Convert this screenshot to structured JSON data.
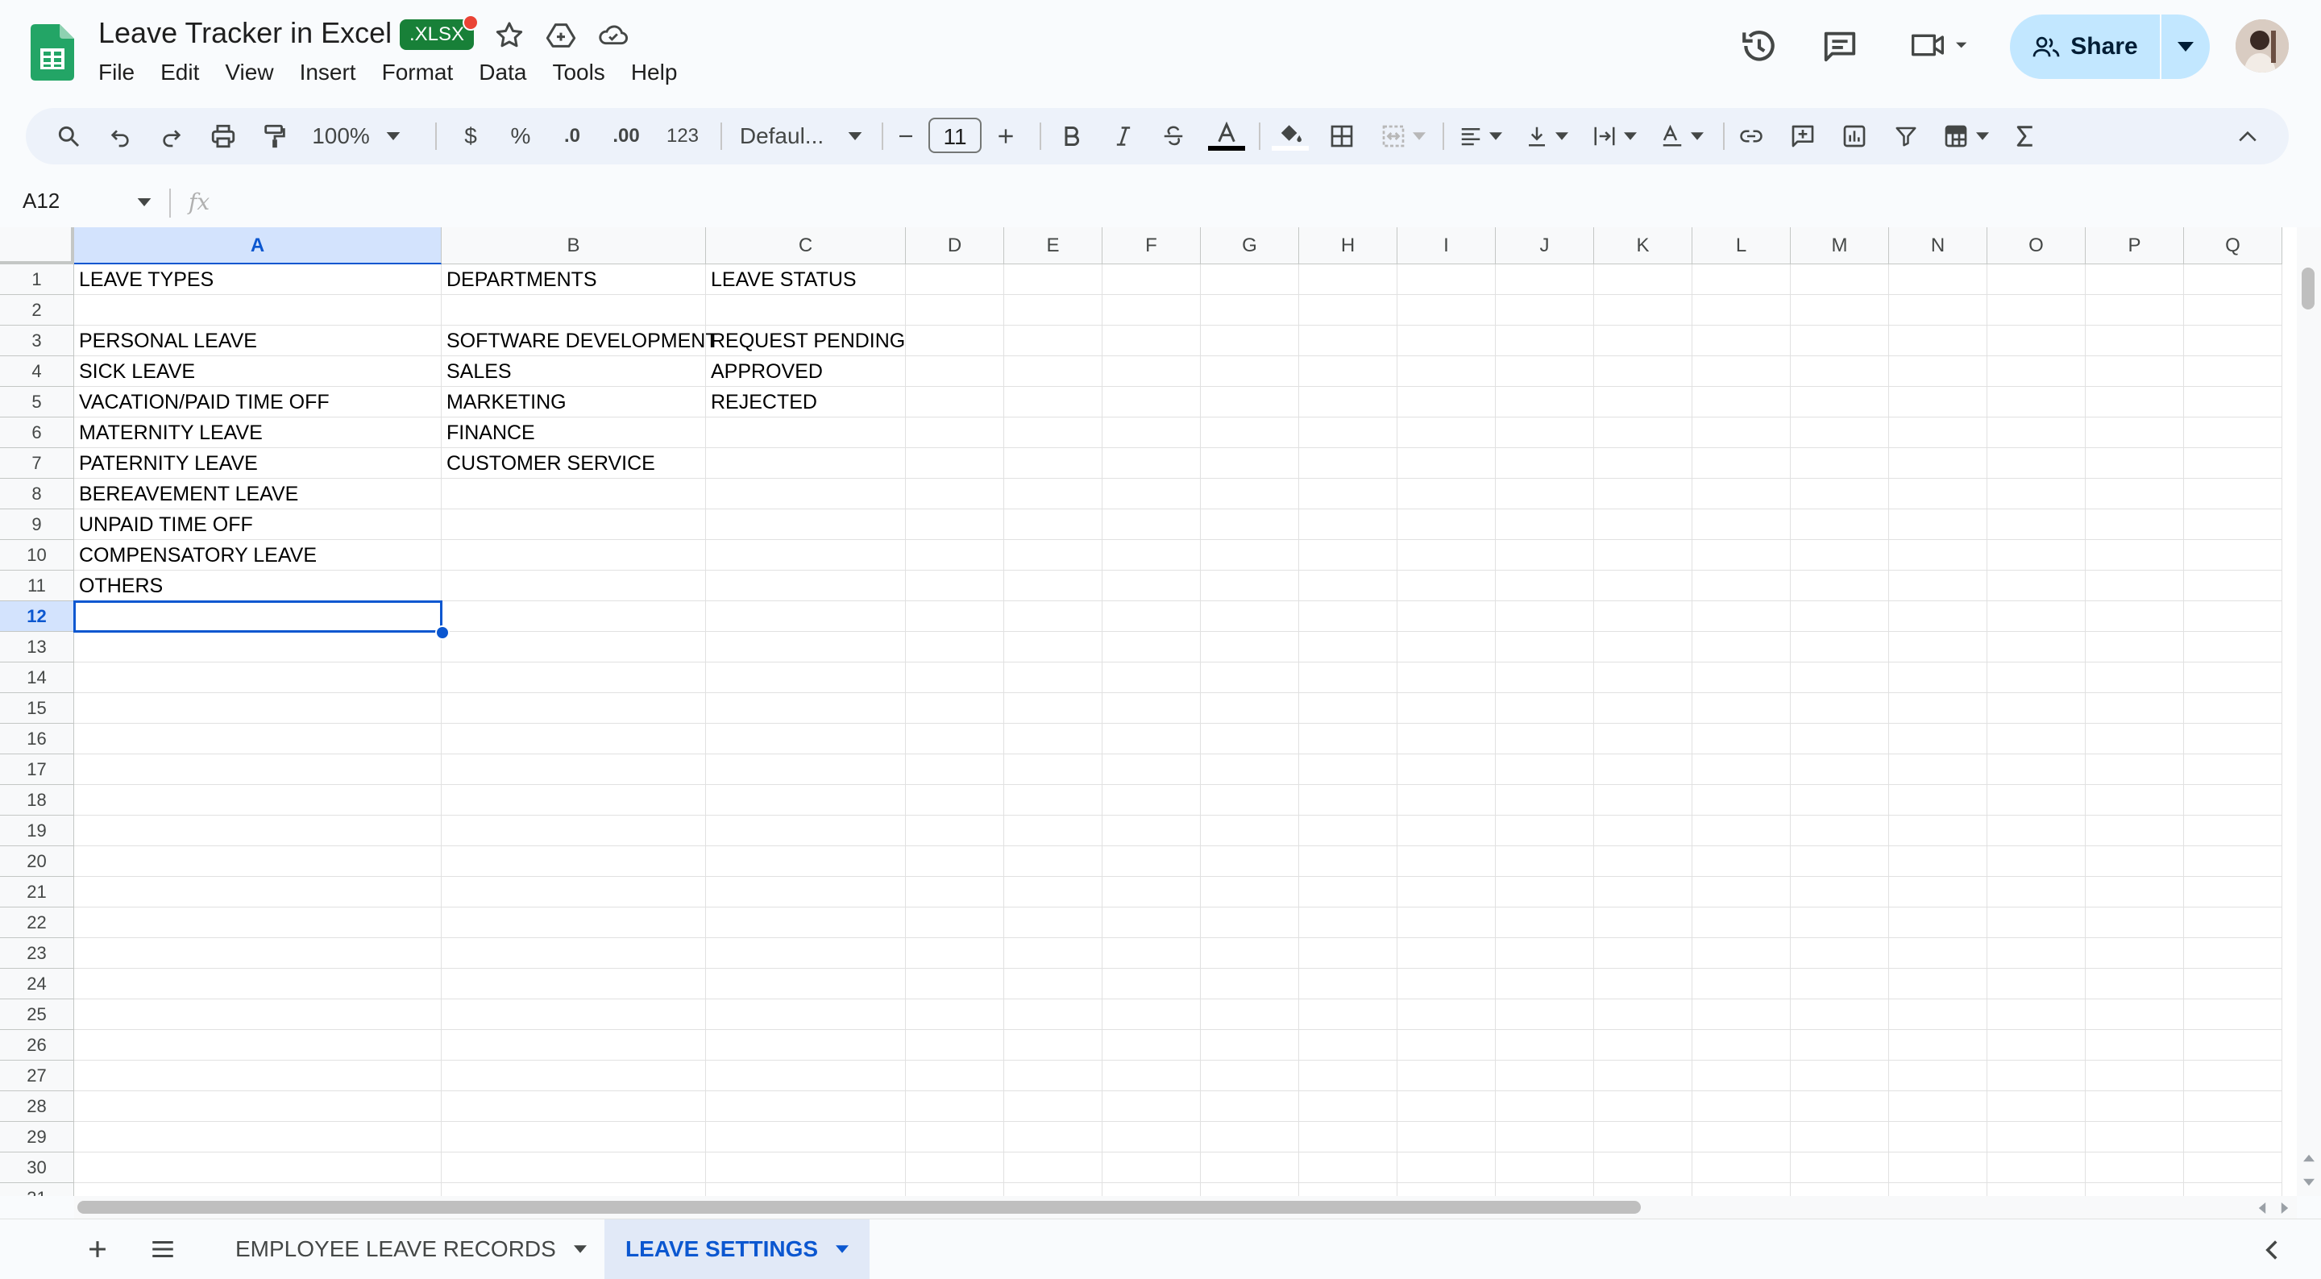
{
  "doc": {
    "title": "Leave Tracker in Excel",
    "format_badge": ".XLSX"
  },
  "menu": [
    "File",
    "Edit",
    "View",
    "Insert",
    "Format",
    "Data",
    "Tools",
    "Help"
  ],
  "share": {
    "label": "Share"
  },
  "toolbar": {
    "zoom": "100%",
    "currency": "$",
    "percent": "%",
    "decrease_decimal": ".0",
    "increase_decimal": ".00",
    "number_format": "123",
    "font": "Defaul...",
    "font_size": "11"
  },
  "formula_bar": {
    "cell_ref": "A12",
    "fx": "fx",
    "content": ""
  },
  "columns": [
    "A",
    "B",
    "C",
    "D",
    "E",
    "F",
    "G",
    "H",
    "I",
    "J",
    "K",
    "L",
    "M",
    "N",
    "O",
    "P",
    "Q"
  ],
  "rows": [
    "1",
    "2",
    "3",
    "4",
    "5",
    "6",
    "7",
    "8",
    "9",
    "10",
    "11",
    "12",
    "13",
    "14",
    "15",
    "16",
    "17",
    "18",
    "19",
    "20",
    "21",
    "22",
    "23",
    "24",
    "25",
    "26",
    "27",
    "28",
    "29",
    "30",
    "31"
  ],
  "cells": {
    "A": [
      "LEAVE TYPES",
      "",
      "PERSONAL LEAVE",
      "SICK LEAVE",
      "VACATION/PAID TIME OFF",
      "MATERNITY LEAVE",
      "PATERNITY LEAVE",
      "BEREAVEMENT LEAVE",
      "UNPAID TIME OFF",
      "COMPENSATORY LEAVE",
      "OTHERS"
    ],
    "B": [
      "DEPARTMENTS",
      "",
      "SOFTWARE DEVELOPMENT",
      "SALES",
      "MARKETING",
      "FINANCE",
      "CUSTOMER SERVICE"
    ],
    "C": [
      "LEAVE STATUS",
      "",
      "REQUEST PENDING",
      "APPROVED",
      "REJECTED"
    ]
  },
  "selection": {
    "column": "A",
    "row": "12"
  },
  "sheets": [
    {
      "name": "EMPLOYEE LEAVE RECORDS",
      "active": false
    },
    {
      "name": "LEAVE SETTINGS",
      "active": true
    }
  ]
}
